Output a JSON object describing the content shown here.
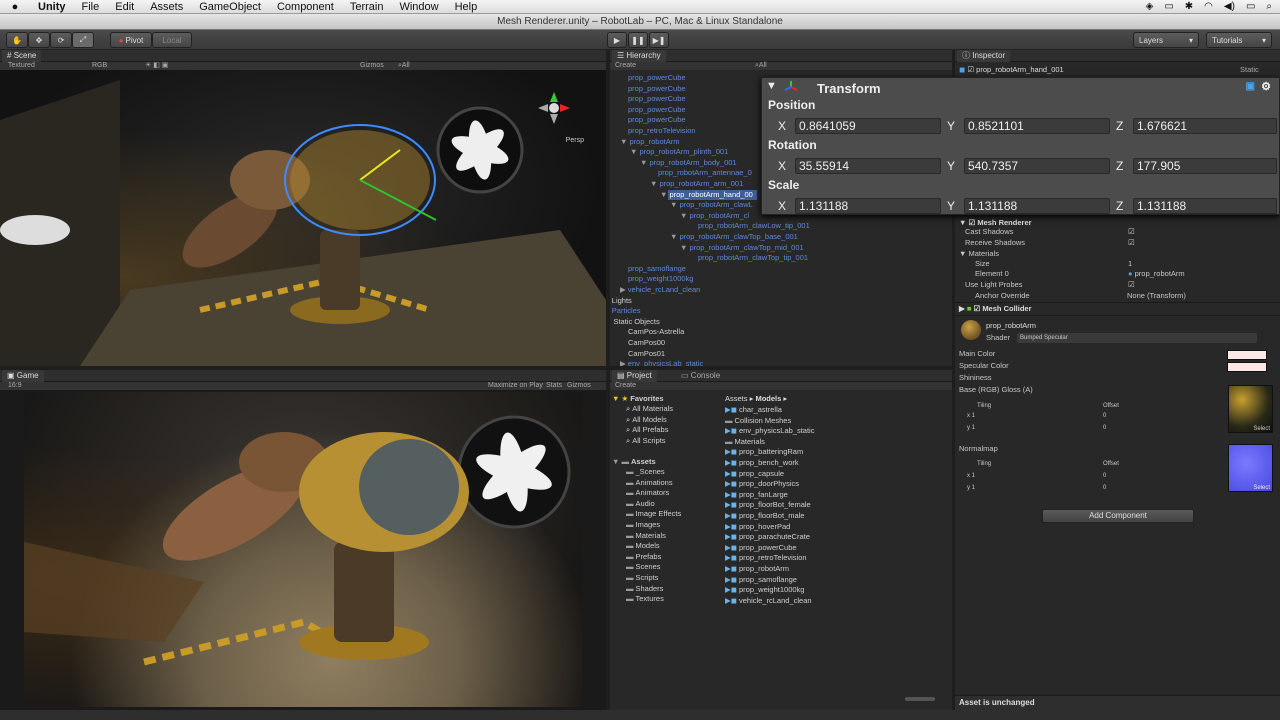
{
  "menubar": {
    "app": "Unity",
    "items": [
      "File",
      "Edit",
      "Assets",
      "GameObject",
      "Component",
      "Terrain",
      "Window",
      "Help"
    ]
  },
  "window_title": "Mesh Renderer.unity – RobotLab – PC, Mac & Linux Standalone",
  "toolbar": {
    "pivot": "Pivot",
    "local": "Local",
    "layers": "Layers",
    "tutorials": "Tutorials"
  },
  "scene": {
    "tab": "Scene",
    "shading": "Textured",
    "render": "RGB",
    "gizmos": "Gizmos",
    "search": "All",
    "persp": "Persp"
  },
  "game": {
    "tab": "Game",
    "aspect": "16:9",
    "maximize": "Maximize on Play",
    "stats": "Stats",
    "gizmos": "Gizmos"
  },
  "hierarchy": {
    "tab": "Hierarchy",
    "create": "Create",
    "search": "All",
    "items": [
      {
        "label": "prop_powerCube",
        "indent": 0,
        "color": "blue"
      },
      {
        "label": "prop_powerCube",
        "indent": 0,
        "color": "blue"
      },
      {
        "label": "prop_powerCube",
        "indent": 0,
        "color": "blue"
      },
      {
        "label": "prop_powerCube",
        "indent": 0,
        "color": "blue"
      },
      {
        "label": "prop_powerCube",
        "indent": 0,
        "color": "blue"
      },
      {
        "label": "prop_retroTelevision",
        "indent": 0,
        "color": "blue"
      },
      {
        "label": "prop_robotArm",
        "indent": 0,
        "color": "blue",
        "arrow": "▼"
      },
      {
        "label": "prop_robotArm_plinth_001",
        "indent": 1,
        "color": "blue",
        "arrow": "▼"
      },
      {
        "label": "prop_robotArm_body_001",
        "indent": 2,
        "color": "blue",
        "arrow": "▼"
      },
      {
        "label": "prop_robotArm_antennae_0",
        "indent": 3,
        "color": "blue"
      },
      {
        "label": "prop_robotArm_arm_001",
        "indent": 3,
        "color": "blue",
        "arrow": "▼"
      },
      {
        "label": "prop_robotArm_hand_00",
        "indent": 4,
        "color": "sel",
        "arrow": "▼"
      },
      {
        "label": "prop_robotArm_clawL",
        "indent": 5,
        "color": "blue",
        "arrow": "▼"
      },
      {
        "label": "prop_robotArm_cl",
        "indent": 6,
        "color": "blue",
        "arrow": "▼"
      },
      {
        "label": "prop_robotArm_clawLow_tip_001",
        "indent": 7,
        "color": "blue"
      },
      {
        "label": "prop_robotArm_clawTop_base_001",
        "indent": 5,
        "color": "blue",
        "arrow": "▼"
      },
      {
        "label": "prop_robotArm_clawTop_mid_001",
        "indent": 6,
        "color": "blue",
        "arrow": "▼"
      },
      {
        "label": "prop_robotArm_clawTop_tip_001",
        "indent": 7,
        "color": "blue"
      },
      {
        "label": "prop_samoflange",
        "indent": 0,
        "color": "blue"
      },
      {
        "label": "prop_weight1000kg",
        "indent": 0,
        "color": "blue"
      },
      {
        "label": "vehicle_rcLand_clean",
        "indent": 0,
        "color": "blue",
        "arrow": "▶"
      },
      {
        "label": "Lights",
        "indent": -1,
        "color": "white",
        "arrow": "▶"
      },
      {
        "label": "Particles",
        "indent": -1,
        "color": "blue",
        "arrow": "▶"
      },
      {
        "label": "Static Objects",
        "indent": -1,
        "color": "white",
        "arrow": "▼"
      },
      {
        "label": "CamPos-Astrella",
        "indent": 0,
        "color": "white"
      },
      {
        "label": "CamPos00",
        "indent": 0,
        "color": "white"
      },
      {
        "label": "CamPos01",
        "indent": 0,
        "color": "white"
      },
      {
        "label": "env_physicsLab_static",
        "indent": 0,
        "color": "blue",
        "arrow": "▶"
      }
    ]
  },
  "inspector": {
    "tab": "Inspector",
    "object_name": "prop_robotArm_hand_001",
    "static": "Static",
    "transform": {
      "title": "Transform",
      "position_label": "Position",
      "rotation_label": "Rotation",
      "scale_label": "Scale",
      "position": {
        "x": "0.8641059",
        "y": "0.8521101",
        "z": "1.676621"
      },
      "rotation": {
        "x": "35.55914",
        "y": "540.7357",
        "z": "177.905"
      },
      "scale": {
        "x": "1.131188",
        "y": "1.131188",
        "z": "1.131188"
      }
    },
    "mesh_renderer": {
      "title": "Mesh Renderer",
      "cast_shadows": "Cast Shadows",
      "receive_shadows": "Receive Shadows",
      "materials": "Materials",
      "size": "Size",
      "size_value": "1",
      "element0": "Element 0",
      "element0_value": "prop_robotArm",
      "use_light_probes": "Use Light Probes",
      "anchor_override": "Anchor Override",
      "anchor_value": "None (Transform)"
    },
    "mesh_collider": "Mesh Collider",
    "material": {
      "name": "prop_robotArm",
      "shader_label": "Shader",
      "shader_value": "Bumped Specular",
      "main_color": "Main Color",
      "specular_color": "Specular Color",
      "shininess": "Shininess",
      "base": "Base (RGB) Gloss (A)",
      "tiling": "Tiling",
      "offset": "Offset",
      "x": "x",
      "y": "y",
      "x_tiling": "1",
      "y_tiling": "1",
      "x_offset": "0",
      "y_offset": "0",
      "select": "Select",
      "normalmap": "Normalmap"
    },
    "add_component": "Add Component",
    "status": "Asset is unchanged"
  },
  "project": {
    "tab": "Project",
    "console_tab": "Console",
    "create": "Create",
    "favorites_label": "Favorites",
    "favorites": [
      "All Materials",
      "All Models",
      "All Prefabs",
      "All Scripts"
    ],
    "assets_label": "Assets",
    "folders": [
      "_Scenes",
      "Animations",
      "Animators",
      "Audio",
      "Image Effects",
      "Images",
      "Materials",
      "Models",
      "Prefabs",
      "Scenes",
      "Scripts",
      "Shaders",
      "Textures"
    ],
    "breadcrumb": [
      "Assets",
      "Models"
    ],
    "models": [
      "char_astrella",
      "Collision Meshes",
      "env_physicsLab_static",
      "Materials",
      "prop_batteringRam",
      "prop_bench_work",
      "prop_capsule",
      "prop_doorPhysics",
      "prop_fanLarge",
      "prop_floorBot_female",
      "prop_floorBot_male",
      "prop_hoverPad",
      "prop_parachuteCrate",
      "prop_powerCube",
      "prop_retroTelevision",
      "prop_robotArm",
      "prop_samoflange",
      "prop_weight1000kg",
      "vehicle_rcLand_clean"
    ]
  },
  "colors": {
    "accent": "#3e5f96",
    "link": "#5f8ad8",
    "panel": "#282828"
  }
}
